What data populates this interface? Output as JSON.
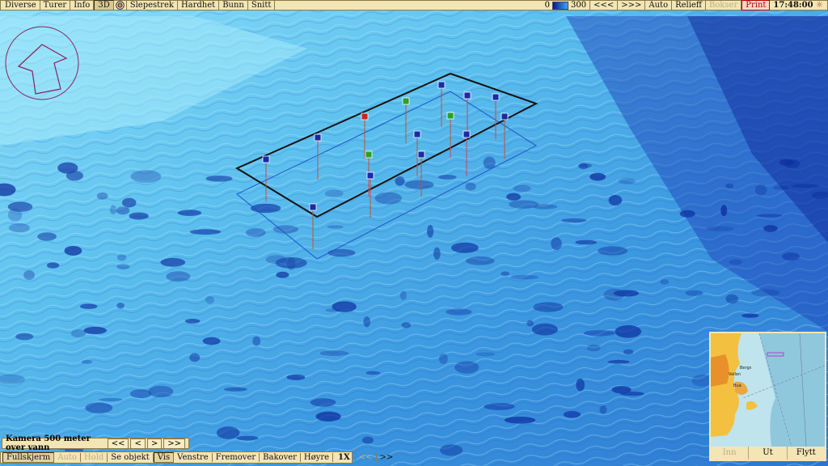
{
  "toolbar": {
    "items": [
      {
        "label": "Diverse"
      },
      {
        "label": "Turer"
      },
      {
        "label": "Info"
      },
      {
        "label": "3D",
        "selected": true
      },
      {
        "label": "Slepestrek"
      },
      {
        "label": "Hardhet"
      },
      {
        "label": "Bunn"
      },
      {
        "label": "Snitt"
      }
    ],
    "scale_min": "0",
    "scale_max": "300",
    "prev": "<<<",
    "next": ">>>",
    "auto": "Auto",
    "relieff": "Relieff",
    "bokser": "Bokser",
    "print": "Print",
    "time": "17:48:00"
  },
  "camera": {
    "label": "Kamera 500 meter over vann",
    "btn_first": "<<",
    "btn_prev": "<",
    "btn_next": ">",
    "btn_last": ">>"
  },
  "bottombar": {
    "fullskjerm": "Fullskjerm",
    "auto": "Auto",
    "hold": "Hold",
    "se_objekt": "Se objekt",
    "vis": "Vis",
    "venstre": "Venstre",
    "fremover": "Fremover",
    "bakover": "Bakover",
    "hoyre": "Høyre",
    "speed": "1X",
    "slower": "<<",
    "faster": ">>"
  },
  "minimap": {
    "btn_inn": "Inn",
    "btn_ut": "Ut",
    "btn_flytt": "Flytt",
    "labels": [
      "Vallen",
      "Bergs",
      "Bua"
    ]
  },
  "colors": {
    "panel": "#f3e6b4",
    "sea_light": "#7fd4f4",
    "sea_mid": "#3a8fd8",
    "sea_deep": "#0b2a9c",
    "marker_blue": "#1a2aa8",
    "marker_red": "#d42020",
    "marker_green": "#2aa02a"
  },
  "icons": {
    "compass": "north-arrow-icon",
    "target": "target-icon"
  }
}
